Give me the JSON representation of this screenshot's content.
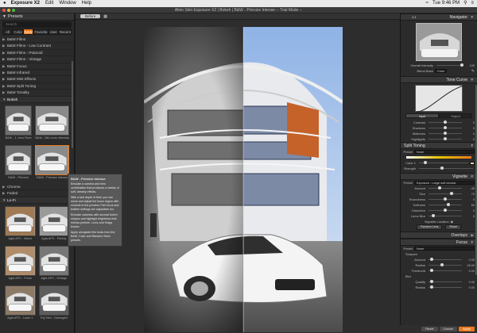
{
  "menubar": {
    "app": "Exposure X2",
    "items": [
      "Edit",
      "Window",
      "Help"
    ],
    "clock": "Tue 9:46 PM"
  },
  "window": {
    "title": "Alien Skin Exposure X2 | Bokeh | B&W - Prinvize Intense -- Trial Mode --"
  },
  "presets": {
    "header": "Presets",
    "search_placeholder": "Search",
    "tabs": [
      "All",
      "Color",
      "B&W",
      "Favorite",
      "User",
      "Recent"
    ],
    "active_tab": 2,
    "categories": [
      "B&W Films",
      "B&W Films - Low Contrast",
      "B&W Films - Polaroid",
      "B&W Films - Vintage",
      "B&W Focus",
      "B&W Infrared",
      "B&W Mist Effects",
      "B&W Split Toning",
      "B&W Tonality",
      "Bokeh"
    ],
    "thumbs": [
      {
        "label": "B&W - 1 Lens Flare"
      },
      {
        "label": "B&W - Mid Lens Intensity"
      },
      {
        "label": "B&W - Prinvize"
      },
      {
        "label": "B&W - Prinvize Intense"
      }
    ],
    "lower_categories": [
      "Chrome",
      "Faded",
      "Lo-Fi"
    ],
    "lofi_thumbs": [
      {
        "label": "Agfa APX - Warm"
      },
      {
        "label": "Agfa APX - Pebbly"
      },
      {
        "label": "Agfa APX - Fresh"
      },
      {
        "label": "Agfa APX - Vintage"
      },
      {
        "label": "Agfa APX - Lomo 1"
      },
      {
        "label": "Fuji Neo - Damaged"
      }
    ]
  },
  "tooltip": {
    "title": "B&W - Prinvize Intense",
    "paragraphs": [
      "Emulate a camera and lens combination that produces a variety of soft, dreamy effects.",
      "With a fast depth of field, you can move and adjust the focus region with controls in the preview. Pan focus and feather settings are adjustable too.",
      "Emulate cameras with several bokeh shapes and highlight brightness that mimics pinhole, Lomo and Holga lenses.",
      "Apply alongside film looks from the B&W, Color and Random Seed presets."
    ]
  },
  "canvas_toolbar": {
    "before_label": "Before"
  },
  "navigator": {
    "title": "Navigator",
    "zoom": "1:1",
    "overall_label": "Overall Intensity",
    "overall_value": "100",
    "blend_label": "Blend Base",
    "blend_value": "Color"
  },
  "tone_curve": {
    "title": "Tone Curve",
    "modes": [
      "Input",
      "Output"
    ],
    "sliders": [
      {
        "label": "Contrast",
        "value": "0",
        "pos": 0.5
      },
      {
        "label": "Shadows",
        "value": "0",
        "pos": 0.5
      },
      {
        "label": "Midtones",
        "value": "0",
        "pos": 0.5
      },
      {
        "label": "Highlights",
        "value": "0",
        "pos": 0.5
      }
    ]
  },
  "split_toning": {
    "title": "Split Toning",
    "preset_label": "Preset",
    "preset_value": "None",
    "color_label": "Color 1",
    "strength_label": "Strength"
  },
  "vignette": {
    "title": "Vignette",
    "preset_label": "Preset",
    "preset_value": "Exposure - Large soft circular",
    "sliders": [
      {
        "label": "Amount",
        "value": "-45",
        "pos": 0.3
      },
      {
        "label": "Size",
        "value": "70",
        "pos": 0.7
      },
      {
        "label": "Roundness",
        "value": "0",
        "pos": 0.5
      },
      {
        "label": "Softness",
        "value": "60",
        "pos": 0.6
      },
      {
        "label": "Distortion",
        "value": "0",
        "pos": 0.5
      },
      {
        "label": "Lomo Blur",
        "value": "0",
        "pos": 0.1
      }
    ],
    "location_label": "Vignette Location",
    "random_btn": "Random Lens",
    "reset_btn": "Reset"
  },
  "overlays": {
    "title": "Overlays"
  },
  "focus": {
    "title": "Focus",
    "preset_label": "Preset",
    "preset_value": "None",
    "sharpen_label": "Sharpen",
    "sharpen_sliders": [
      {
        "label": "Amount",
        "value": "0.00",
        "pos": 0.05
      },
      {
        "label": "Radius",
        "value": "28.00",
        "pos": 0.4
      },
      {
        "label": "Threshold",
        "value": "0.00",
        "pos": 0.05
      }
    ],
    "blur_label": "Blur",
    "blur_sliders": [
      {
        "label": "Quality",
        "value": "0.00",
        "pos": 0.05
      },
      {
        "label": "Radius",
        "value": "0.00",
        "pos": 0.05
      }
    ]
  },
  "bottombar": {
    "reset": "Reset",
    "cancel": "Cancel",
    "apply": "Apply"
  },
  "colors": {
    "accent": "#e9791d",
    "panel": "#2b2b2b",
    "background": "#1e1e1e"
  }
}
